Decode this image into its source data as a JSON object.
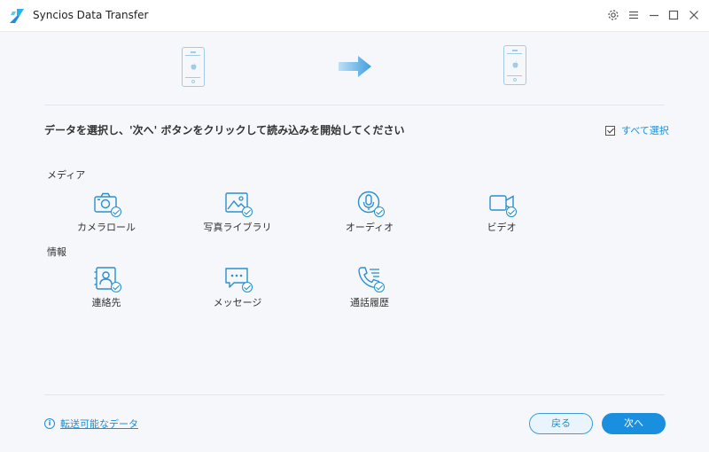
{
  "window": {
    "title": "Syncios Data Transfer",
    "controls": [
      "settings-icon",
      "menu-icon",
      "minimize-icon",
      "maximize-icon",
      "close-icon"
    ]
  },
  "transfer": {
    "source_device": "iphone-icon",
    "target_device": "iphone-icon",
    "direction": "arrow-right-icon"
  },
  "instruction": "データを選択し、'次へ' ボタンをクリックして読み込みを開始してください",
  "select_all": {
    "label": "すべて選択",
    "checked": true
  },
  "sections": {
    "media": {
      "label": "メディア",
      "items": [
        {
          "label": "カメラロール",
          "icon": "camera-icon",
          "checked": true
        },
        {
          "label": "写真ライブラリ",
          "icon": "photo-library-icon",
          "checked": true
        },
        {
          "label": "オーディオ",
          "icon": "audio-icon",
          "checked": true
        },
        {
          "label": "ビデオ",
          "icon": "video-icon",
          "checked": true
        }
      ]
    },
    "info": {
      "label": "情報",
      "items": [
        {
          "label": "連絡先",
          "icon": "contacts-icon",
          "checked": true
        },
        {
          "label": "メッセージ",
          "icon": "messages-icon",
          "checked": true
        },
        {
          "label": "通話履歴",
          "icon": "call-history-icon",
          "checked": true
        }
      ]
    }
  },
  "footer": {
    "info_link": "転送可能なデータ",
    "back_button": "戻る",
    "next_button": "次へ"
  },
  "colors": {
    "accent": "#1a8fe0",
    "icon_stroke": "#2a8fd0",
    "device_stroke": "#9fcde8",
    "panel_bg": "#f5f7fa"
  }
}
